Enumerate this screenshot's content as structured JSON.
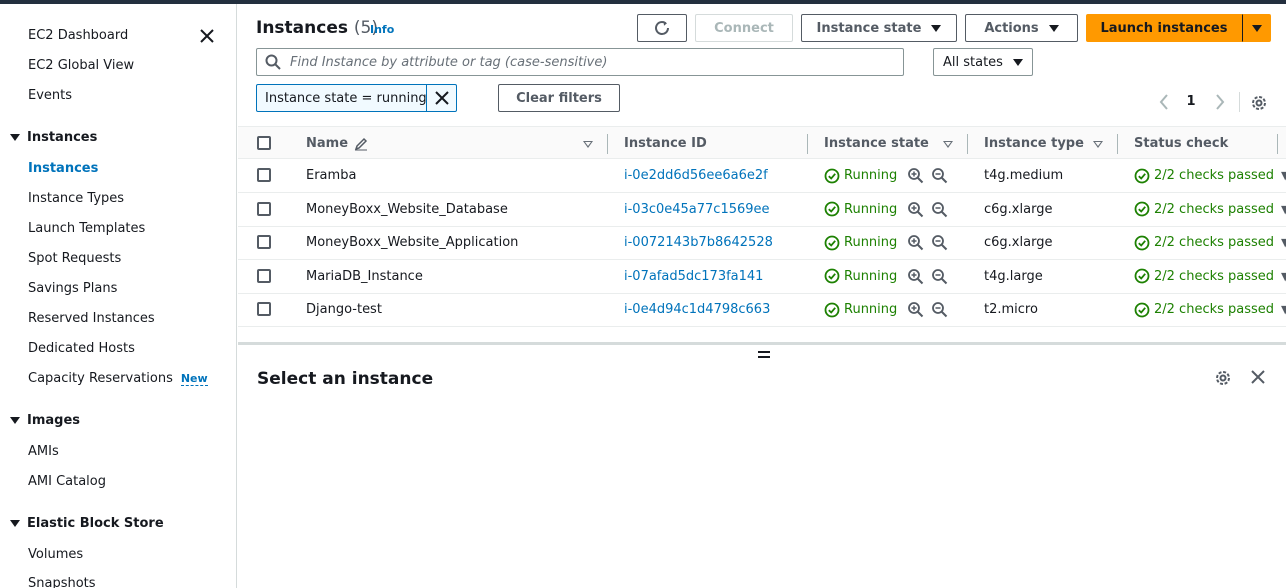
{
  "sidebar": {
    "items": [
      {
        "label": "EC2 Dashboard"
      },
      {
        "label": "EC2 Global View"
      },
      {
        "label": "Events"
      }
    ],
    "sections": [
      {
        "label": "Instances",
        "items": [
          "Instances",
          "Instance Types",
          "Launch Templates",
          "Spot Requests",
          "Savings Plans",
          "Reserved Instances",
          "Dedicated Hosts",
          "Capacity Reservations"
        ]
      },
      {
        "label": "Images",
        "items": [
          "AMIs",
          "AMI Catalog"
        ]
      },
      {
        "label": "Elastic Block Store",
        "items": [
          "Volumes",
          "Snapshots"
        ]
      }
    ],
    "new_badge": "New"
  },
  "header": {
    "title": "Instances",
    "count": "(5)",
    "info": "Info",
    "connect_label": "Connect",
    "instance_state_label": "Instance state",
    "actions_label": "Actions",
    "launch_label": "Launch instances"
  },
  "filters": {
    "search_placeholder": "Find Instance by attribute or tag (case-sensitive)",
    "state_select": "All states",
    "token": "Instance state = running",
    "clear_label": "Clear filters"
  },
  "pagination": {
    "page": "1"
  },
  "table": {
    "columns": [
      "Name",
      "Instance ID",
      "Instance state",
      "Instance type",
      "Status check"
    ],
    "rows": [
      {
        "name": "Eramba",
        "id": "i-0e2dd6d56ee6a6e2f",
        "state": "Running",
        "type": "t4g.medium",
        "status": "2/2 checks passed"
      },
      {
        "name": "MoneyBoxx_Website_Database",
        "id": "i-03c0e45a77c1569ee",
        "state": "Running",
        "type": "c6g.xlarge",
        "status": "2/2 checks passed"
      },
      {
        "name": "MoneyBoxx_Website_Application",
        "id": "i-0072143b7b8642528",
        "state": "Running",
        "type": "c6g.xlarge",
        "status": "2/2 checks passed"
      },
      {
        "name": "MariaDB_Instance",
        "id": "i-07afad5dc173fa141",
        "state": "Running",
        "type": "t4g.large",
        "status": "2/2 checks passed"
      },
      {
        "name": "Django-test",
        "id": "i-0e4d94c1d4798c663",
        "state": "Running",
        "type": "t2.micro",
        "status": "2/2 checks passed"
      }
    ]
  },
  "split_panel": {
    "title": "Select an instance"
  },
  "colors": {
    "accent": "#0073bb",
    "primary": "#ff9900",
    "success": "#1d8102",
    "text": "#16191f"
  }
}
